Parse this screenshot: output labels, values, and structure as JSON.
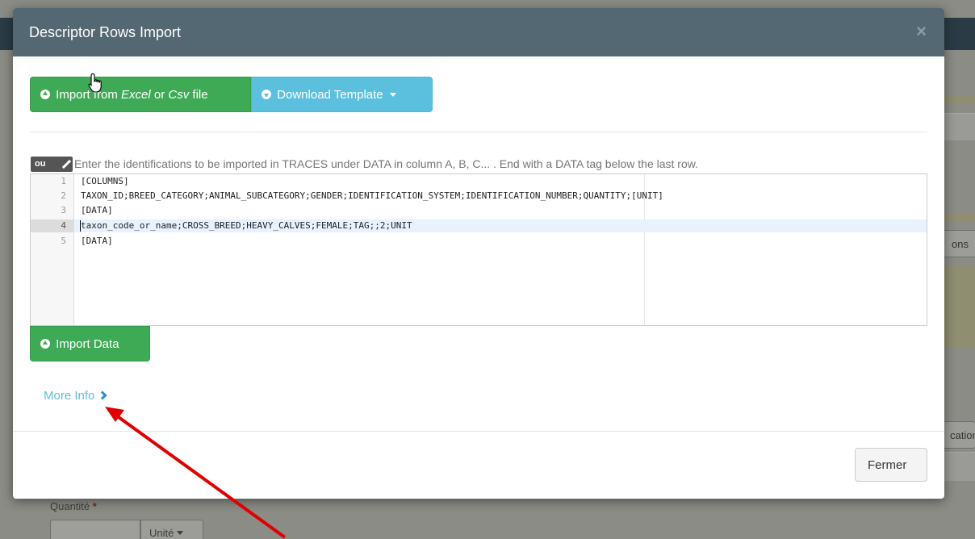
{
  "modal": {
    "title": "Descriptor Rows Import",
    "close_glyph": "×",
    "import_file": {
      "prefix": "Import from ",
      "excel": "Excel",
      "or": " or ",
      "csv": "Csv",
      "suffix": " file"
    },
    "download_template_label": "Download Template",
    "ou_badge": "ou",
    "help_text": "Enter the identifications to be imported in TRACES under DATA in column A, B, C... . End with a DATA tag below the last row.",
    "editor_lines": [
      {
        "num": "1",
        "text": "[COLUMNS]"
      },
      {
        "num": "2",
        "text": "TAXON_ID;BREED_CATEGORY;ANIMAL_SUBCATEGORY;GENDER;IDENTIFICATION_SYSTEM;IDENTIFICATION_NUMBER;QUANTITY;[UNIT]"
      },
      {
        "num": "3",
        "text": "[DATA]"
      },
      {
        "num": "4",
        "text": "taxon_code_or_name;CROSS_BREED;HEAVY_CALVES;FEMALE;TAG;;2;UNIT"
      },
      {
        "num": "5",
        "text": "[DATA]"
      }
    ],
    "active_line": 4,
    "import_data_label": "Import Data",
    "more_info_label": "More Info",
    "close_button_label": "Fermer"
  },
  "background": {
    "side_button_right": "ons",
    "side_button_right_2": "catior",
    "quantity_label": "Quantité",
    "required_mark": "*",
    "unit_label": "Unité"
  },
  "colors": {
    "header_bg": "#546874",
    "success": "#3faa56",
    "info": "#5bc0de",
    "annotation_arrow": "#e00000"
  },
  "icons": {
    "import_file": "circle-arrow-up-icon",
    "download_template": "circle-arrow-down-icon",
    "dropdown": "caret-down-icon",
    "edit": "pencil-icon",
    "import_data": "circle-arrow-up-icon",
    "more_info": "chevron-right-icon",
    "close": "close-icon",
    "pointer": "hand-pointer-cursor-icon"
  }
}
